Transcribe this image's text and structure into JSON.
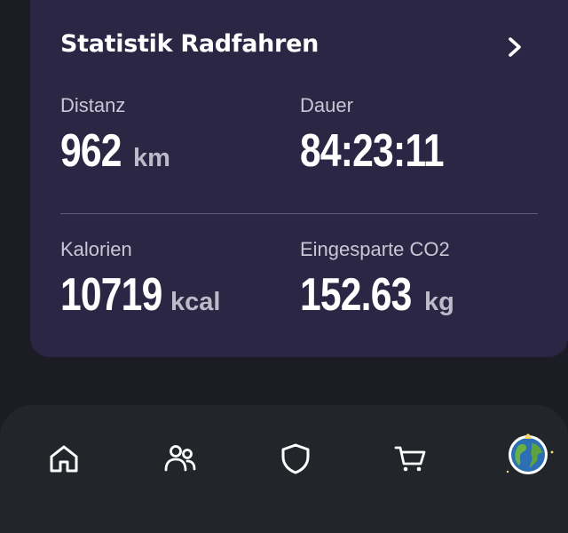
{
  "card": {
    "title": "Statistik Radfahren",
    "stats": [
      {
        "label": "Distanz",
        "value": "962",
        "unit": "km"
      },
      {
        "label": "Dauer",
        "value": "84:23:11",
        "unit": ""
      },
      {
        "label": "Kalorien",
        "value": "10719",
        "unit": "kcal"
      },
      {
        "label": "Eingesparte CO2",
        "value": "152.63",
        "unit": "kg"
      }
    ]
  },
  "nav": {
    "items": [
      {
        "icon": "home-icon"
      },
      {
        "icon": "people-icon"
      },
      {
        "icon": "shield-icon"
      },
      {
        "icon": "cart-icon"
      },
      {
        "icon": "globe-icon"
      }
    ]
  },
  "colors": {
    "background": "#1c1c24",
    "card": "#2a2644",
    "nav": "#22262b",
    "text_primary": "#ffffff",
    "text_secondary": "#c9c7d6",
    "unit": "#bdbbc9"
  }
}
